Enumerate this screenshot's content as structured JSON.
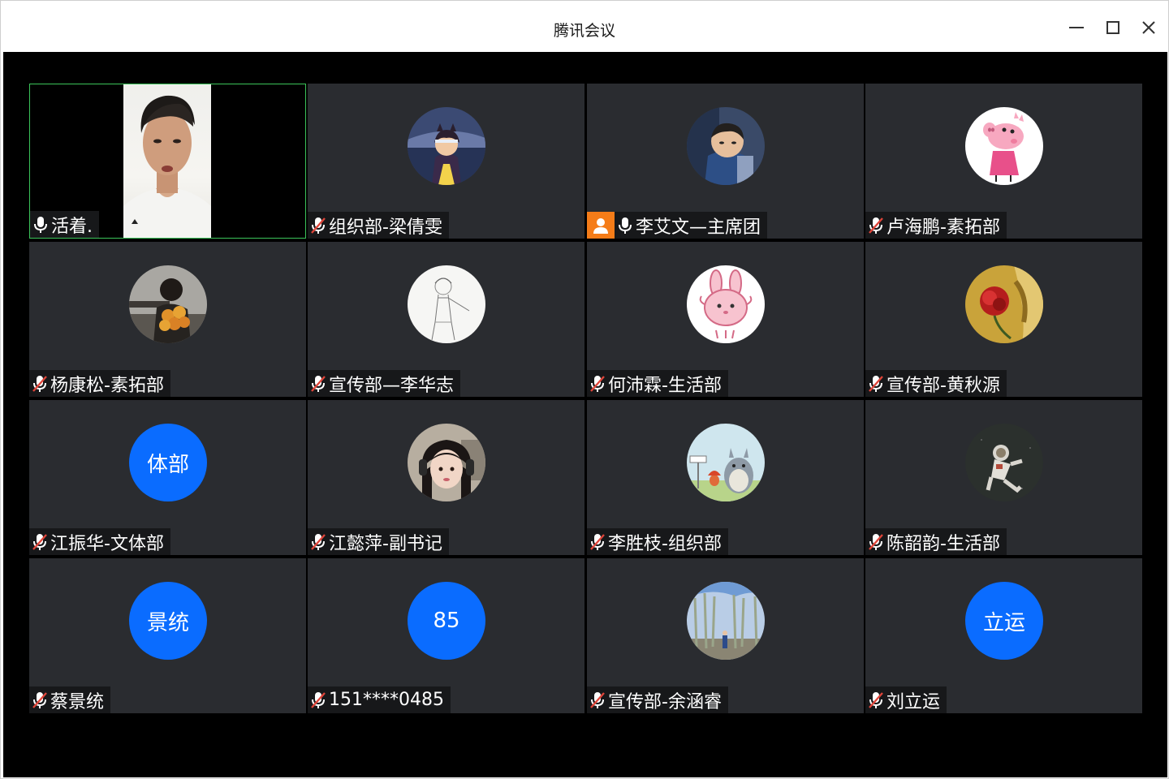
{
  "window": {
    "title": "腾讯会议"
  },
  "participants": [
    {
      "name": "活着.",
      "mic": "on",
      "video": true
    },
    {
      "name": "组织部-梁倩雯",
      "mic": "muted",
      "avatar": "night-cat-girl"
    },
    {
      "name": "李艾文—主席团",
      "mic": "on",
      "host": true,
      "avatar": "child-photo"
    },
    {
      "name": "卢海鹏-素拓部",
      "mic": "muted",
      "avatar": "peppa-pig"
    },
    {
      "name": "杨康松-素拓部",
      "mic": "muted",
      "avatar": "sunflower-bouquet"
    },
    {
      "name": "宣传部—李华志",
      "mic": "muted",
      "avatar": "sketch-boy"
    },
    {
      "name": "何沛霖-生活部",
      "mic": "muted",
      "avatar": "pink-bunny"
    },
    {
      "name": "宣传部-黄秋源",
      "mic": "muted",
      "avatar": "red-rose"
    },
    {
      "name": "江振华-文体部",
      "mic": "muted",
      "avatar_text": "体部"
    },
    {
      "name": "江懿萍-副书记",
      "mic": "muted",
      "avatar": "girl-headphones"
    },
    {
      "name": "李胜枝-组织部",
      "mic": "muted",
      "avatar": "totoro"
    },
    {
      "name": "陈韶韵-生活部",
      "mic": "muted",
      "avatar": "astronaut"
    },
    {
      "name": "蔡景统",
      "mic": "muted",
      "avatar_text": "景统"
    },
    {
      "name": "151****0485",
      "mic": "muted",
      "avatar_text": "85"
    },
    {
      "name": "宣传部-余涵睿",
      "mic": "muted",
      "avatar": "birch-forest"
    },
    {
      "name": "刘立运",
      "mic": "muted",
      "avatar_text": "立运"
    }
  ],
  "colors": {
    "tile_bg": "#2a2c30",
    "active_border": "#3bc45a",
    "avatar_blue": "#0a6cff",
    "host_badge": "#f57c18",
    "muted_red": "#e0453a"
  }
}
